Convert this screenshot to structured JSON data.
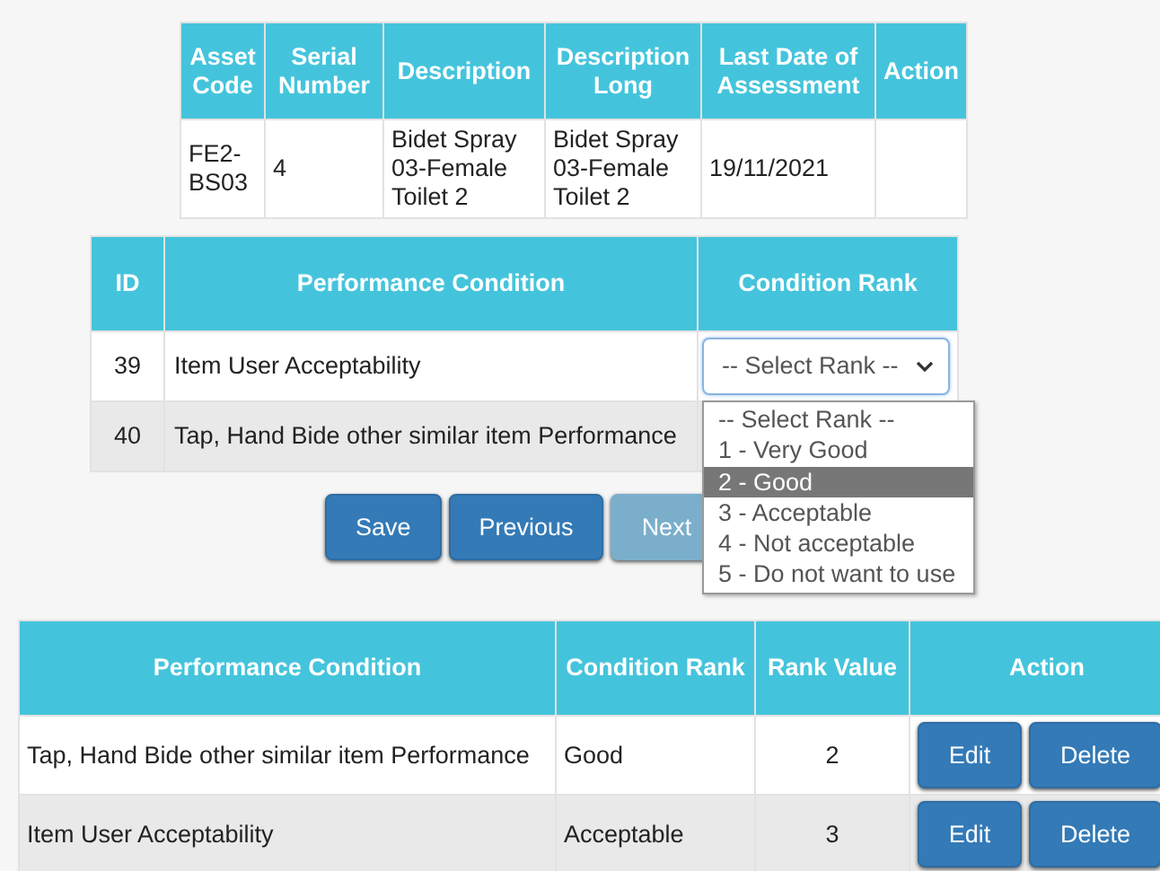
{
  "asset_table": {
    "columns": [
      "Asset Code",
      "Serial Number",
      "Description",
      "Description Long",
      "Last Date of Assessment",
      "Action"
    ],
    "rows": [
      {
        "asset_code": "FE2-BS03",
        "serial_number": "4",
        "description": "Bidet Spray 03-Female Toilet 2",
        "description_long": "Bidet Spray 03-Female Toilet 2",
        "last_date": "19/11/2021"
      }
    ]
  },
  "performance_table": {
    "columns": [
      "ID",
      "Performance Condition",
      "Condition Rank"
    ],
    "rows": [
      {
        "id": "39",
        "condition": "Item User Acceptability",
        "rank_select": {
          "value": "-- Select Rank --",
          "open": true,
          "options": [
            {
              "label": "-- Select Rank --",
              "highlighted": false
            },
            {
              "label": "1 - Very Good",
              "highlighted": false
            },
            {
              "label": "2 - Good",
              "highlighted": true
            },
            {
              "label": "3 - Acceptable",
              "highlighted": false
            },
            {
              "label": "4 - Not acceptable",
              "highlighted": false
            },
            {
              "label": "5 - Do not want to use",
              "highlighted": false
            }
          ]
        }
      },
      {
        "id": "40",
        "condition": "Tap, Hand Bide other similar item Performance"
      }
    ]
  },
  "buttons": [
    {
      "label": "Save",
      "disabled": false
    },
    {
      "label": "Previous",
      "disabled": false
    },
    {
      "label": "Next",
      "disabled": true
    }
  ],
  "results_table": {
    "columns": [
      "Performance Condition",
      "Condition Rank",
      "Rank Value",
      "Action"
    ],
    "rows": [
      {
        "condition": "Tap, Hand Bide other similar item Performance",
        "rank": "Good",
        "value": "2",
        "actions": [
          "Edit",
          "Delete"
        ]
      },
      {
        "condition": "Item User Acceptability",
        "rank": "Acceptable",
        "value": "3",
        "actions": [
          "Edit",
          "Delete"
        ]
      }
    ]
  }
}
